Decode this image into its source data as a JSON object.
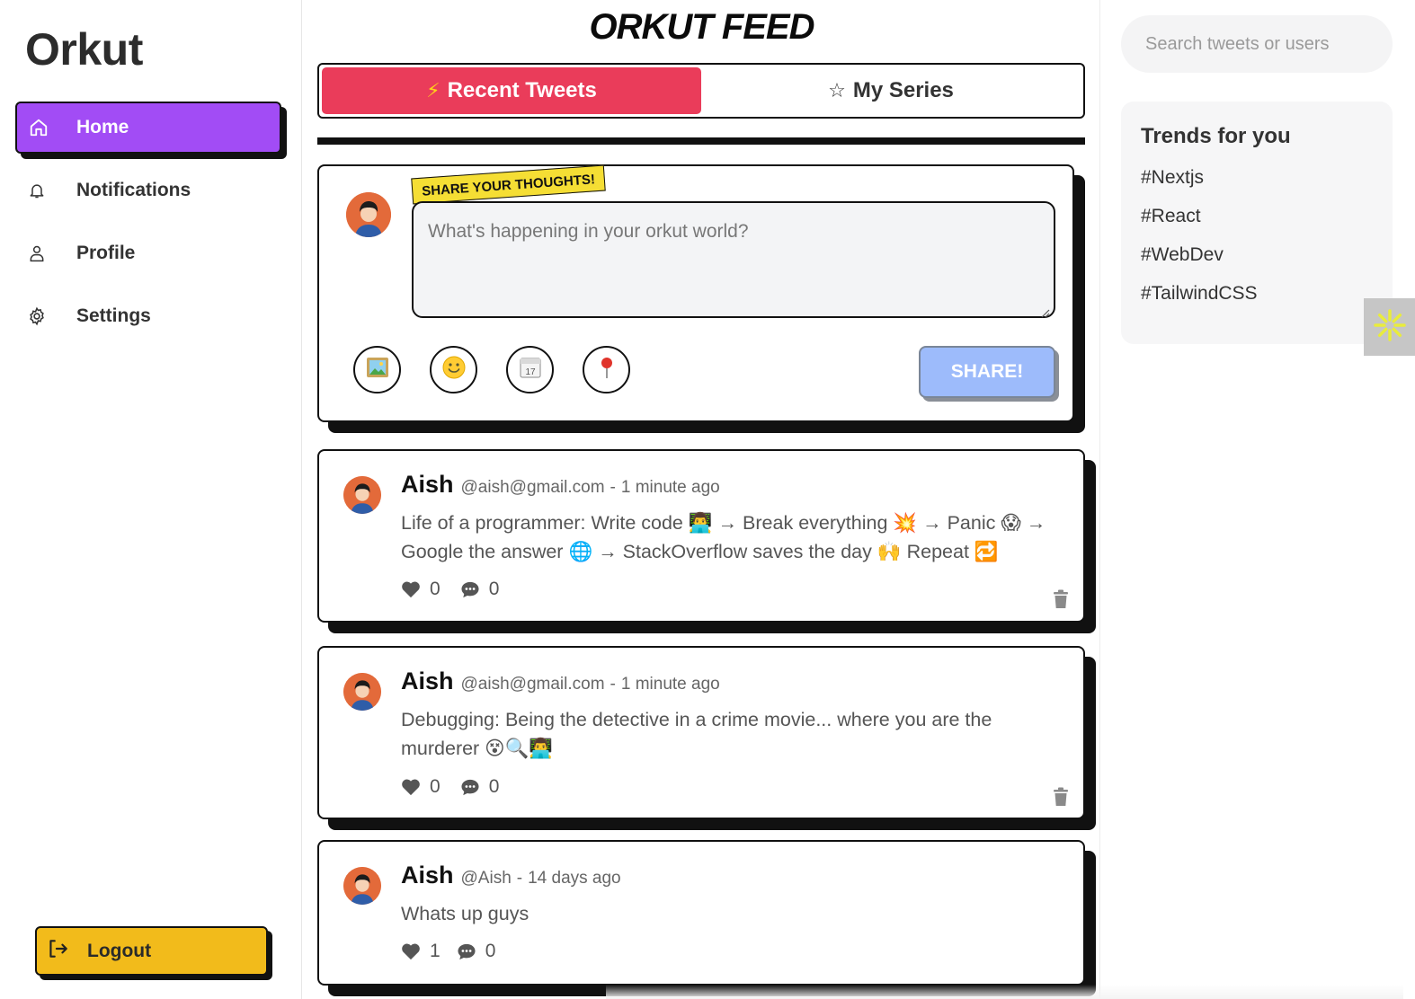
{
  "app": {
    "name": "Orkut"
  },
  "sidebar": {
    "items": [
      {
        "label": "Home",
        "icon": "home-icon",
        "active": true
      },
      {
        "label": "Notifications",
        "icon": "bell-icon",
        "active": false
      },
      {
        "label": "Profile",
        "icon": "user-icon",
        "active": false
      },
      {
        "label": "Settings",
        "icon": "gear-icon",
        "active": false
      }
    ],
    "logout_label": "Logout"
  },
  "feed": {
    "title": "ORKUT FEED",
    "tabs": [
      {
        "label": "Recent Tweets",
        "glyph": "⚡",
        "active": true
      },
      {
        "label": "My Series",
        "glyph": "☆",
        "active": false
      }
    ],
    "composer": {
      "sticker": "SHARE YOUR THOUGHTS!",
      "placeholder": "What's happening in your orkut world?",
      "tools": [
        "image-icon",
        "emoji-icon",
        "calendar-icon",
        "location-pin-icon"
      ],
      "share_label": "SHARE!"
    },
    "tweets": [
      {
        "author": "Aish",
        "handle": "@aish@gmail.com",
        "time": "1 minute ago",
        "text": "Life of a programmer: Write code 👨‍💻 → Break everything 💥 → Panic 😱 → Google the answer 🌐 → StackOverflow saves the day 🙌 Repeat 🔁",
        "likes": "0",
        "comments": "0"
      },
      {
        "author": "Aish",
        "handle": "@aish@gmail.com",
        "time": "1 minute ago",
        "text": "Debugging: Being the detective in a crime movie... where you are the murderer 😵🔍👨‍💻",
        "likes": "0",
        "comments": "0"
      },
      {
        "author": "Aish",
        "handle": "@Aish",
        "time": "14 days ago",
        "text": "Whats up guys",
        "likes": "1",
        "comments": "0"
      }
    ]
  },
  "right": {
    "search_placeholder": "Search tweets or users",
    "trends_title": "Trends for you",
    "trends": [
      "#Nextjs",
      "#React",
      "#WebDev",
      "#TailwindCSS"
    ]
  },
  "colors": {
    "home_active": "#a24cf5",
    "tab_active": "#ea3c5a",
    "logout": "#f2bb1b",
    "sticker": "#f5de34",
    "share_button": "#9dbbfb"
  }
}
